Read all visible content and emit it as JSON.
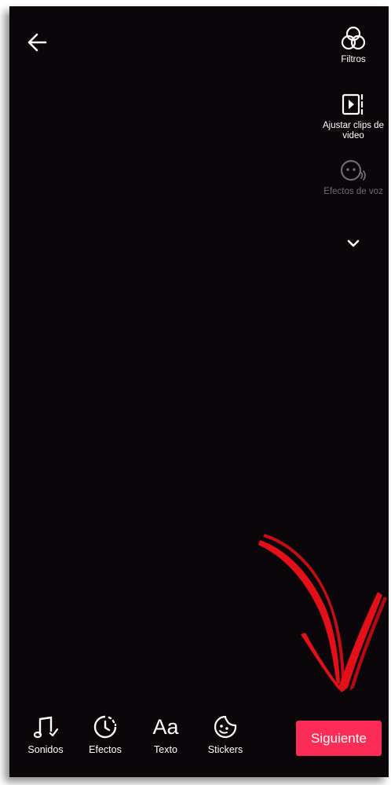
{
  "sidebar": {
    "filters_label": "Filtros",
    "adjust_clips_label": "Ajustar clips de video",
    "voice_effects_label": "Efectos de voz"
  },
  "toolbar": {
    "sounds_label": "Sonidos",
    "effects_label": "Efectos",
    "text_icon_glyph": "Aa",
    "text_label": "Texto",
    "stickers_label": "Stickers",
    "next_label": "Siguiente"
  },
  "colors": {
    "background": "#0a0609",
    "accent_button": "#fb2c55",
    "annotation_arrow": "#e3101a",
    "disabled_text": "#6d6b6e"
  }
}
